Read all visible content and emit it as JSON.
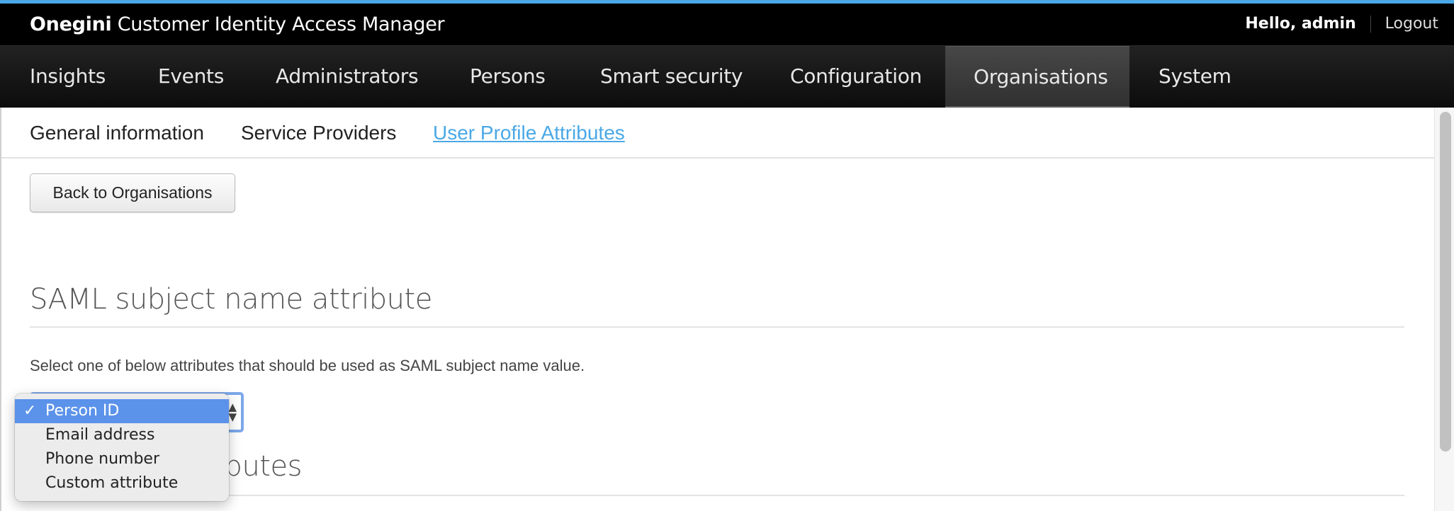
{
  "header": {
    "brand": "Onegini",
    "title": "Customer Identity Access Manager",
    "greeting": "Hello, admin",
    "logout": "Logout"
  },
  "nav": {
    "items": [
      {
        "label": "Insights",
        "active": false
      },
      {
        "label": "Events",
        "active": false
      },
      {
        "label": "Administrators",
        "active": false
      },
      {
        "label": "Persons",
        "active": false
      },
      {
        "label": "Smart security",
        "active": false
      },
      {
        "label": "Configuration",
        "active": false
      },
      {
        "label": "Organisations",
        "active": true
      },
      {
        "label": "System",
        "active": false
      }
    ]
  },
  "subnav": {
    "items": [
      {
        "label": "General information",
        "active": false
      },
      {
        "label": "Service Providers",
        "active": false
      },
      {
        "label": "User Profile Attributes",
        "active": true
      }
    ]
  },
  "main": {
    "back_button": "Back to Organisations",
    "saml_section": {
      "title": "SAML subject name attribute",
      "description": "Select one of below attributes that should be used as SAML subject name value.",
      "select": {
        "selected": "Person ID",
        "options": [
          "Person ID",
          "Email address",
          "Phone number",
          "Custom attribute"
        ]
      }
    },
    "next_section_title_partial": "ributes"
  },
  "colors": {
    "accent": "#4aa8e6",
    "selected_option": "#5b92ea",
    "focus_ring": "#7da8ea"
  }
}
